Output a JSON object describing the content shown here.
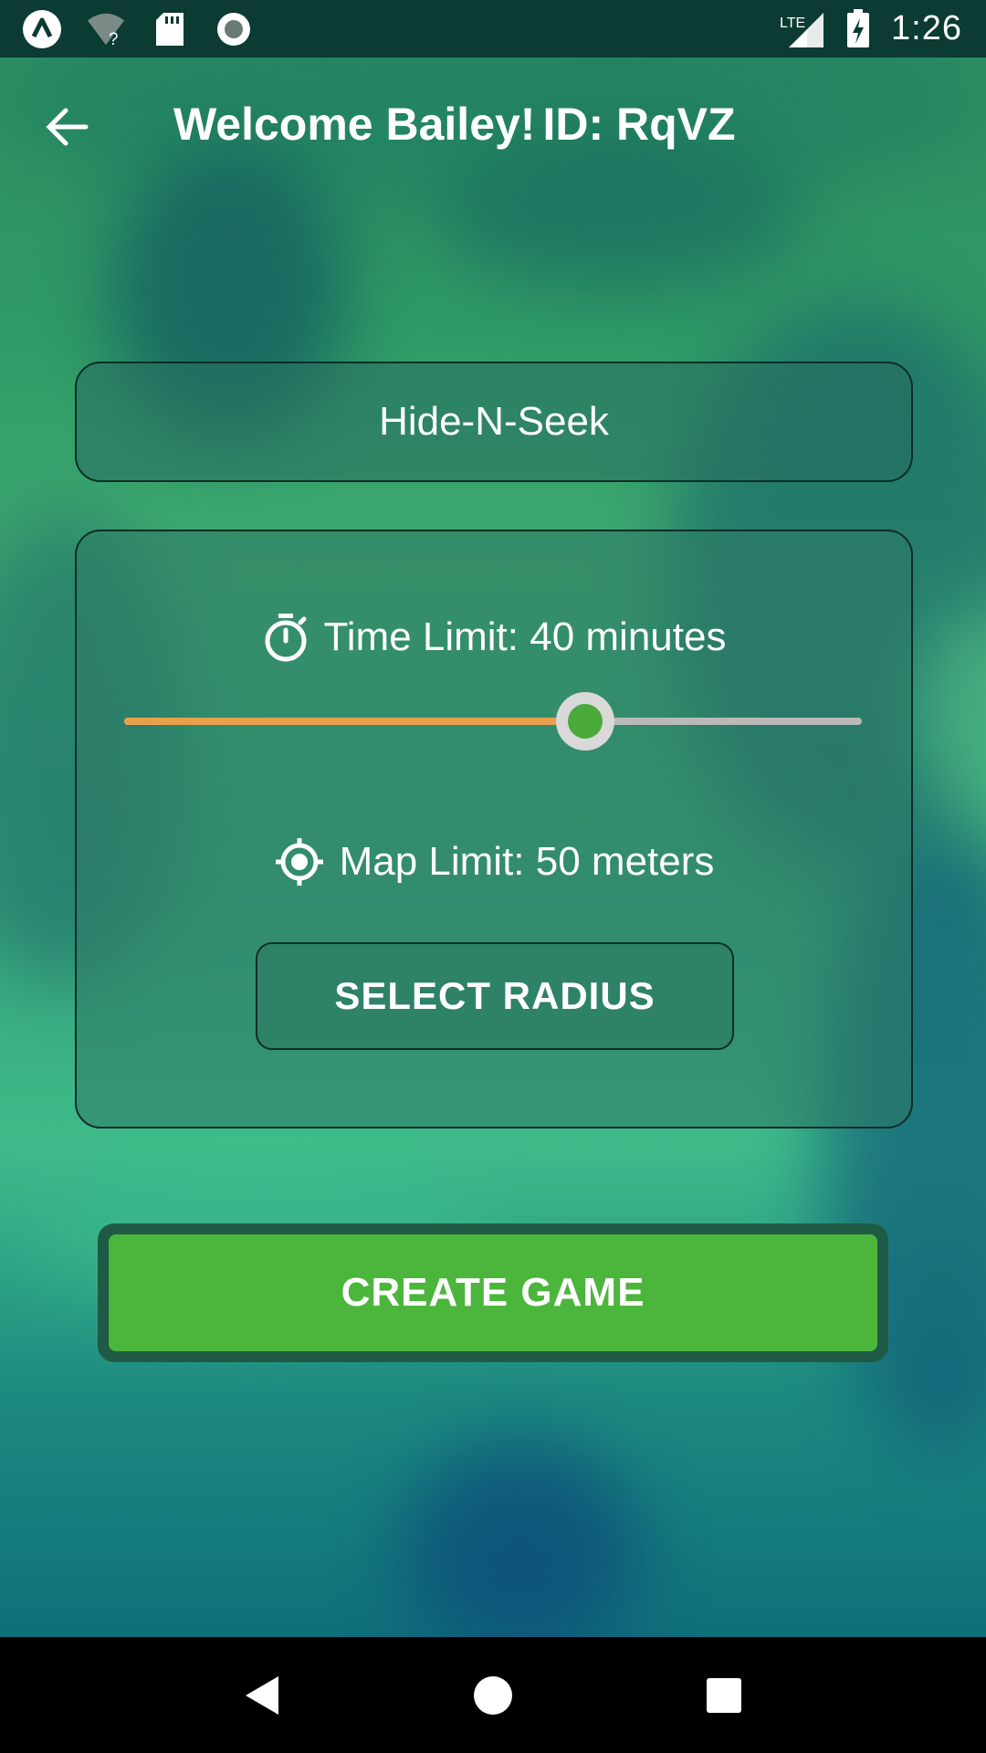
{
  "status_bar": {
    "time": "1:26",
    "network": "LTE",
    "icons": [
      "app-launcher-icon",
      "wifi-unknown-icon",
      "sd-card-icon",
      "record-icon",
      "signal-icon",
      "battery-charging-icon"
    ]
  },
  "app_bar": {
    "back_icon": "arrow-left-icon",
    "welcome": "Welcome Bailey!",
    "game_id": "ID: RqVZ"
  },
  "game": {
    "mode": "Hide-N-Seek"
  },
  "settings": {
    "time_icon": "stopwatch-icon",
    "time_label": "Time Limit: 40 minutes",
    "time_slider_fraction": 0.625,
    "map_icon": "crosshair-icon",
    "map_label": "Map Limit: 50 meters",
    "select_radius_label": "SELECT RADIUS"
  },
  "actions": {
    "create_label": "CREATE GAME"
  },
  "colors": {
    "accent_green": "#4cb53b",
    "slider_fill": "#e8a14a",
    "slider_thumb": "#4aaa3a"
  },
  "nav_bar": {
    "icons": [
      "nav-back-icon",
      "nav-home-icon",
      "nav-recents-icon"
    ]
  }
}
